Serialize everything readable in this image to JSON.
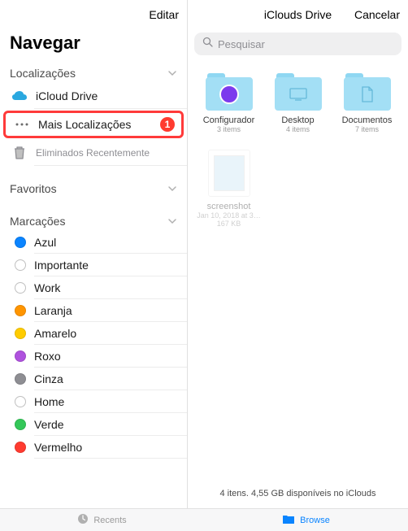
{
  "sidebar": {
    "edit_label": "Editar",
    "title": "Navegar",
    "sections": {
      "locations": {
        "header": "Localizações",
        "items": [
          {
            "label": "iCloud Drive"
          },
          {
            "label": "Mais Localizações",
            "badge": "1"
          },
          {
            "label": "Eliminados Recentemente"
          }
        ]
      },
      "favorites": {
        "header": "Favoritos"
      },
      "tags": {
        "header": "Marcações",
        "items": [
          {
            "label": "Azul",
            "color": "#0a84ff"
          },
          {
            "label": "Importante",
            "hollow": true
          },
          {
            "label": "Work",
            "hollow": true
          },
          {
            "label": "Laranja",
            "color": "#ff9500"
          },
          {
            "label": "Amarelo",
            "color": "#ffcc00"
          },
          {
            "label": "Roxo",
            "color": "#af52de"
          },
          {
            "label": "Cinza",
            "color": "#8e8e93"
          },
          {
            "label": "Home",
            "hollow": true
          },
          {
            "label": "Verde",
            "color": "#34c759"
          },
          {
            "label": "Vermelho",
            "color": "#ff3b30"
          }
        ]
      }
    }
  },
  "main": {
    "title": "iClouds Drive",
    "cancel_label": "Cancelar",
    "search_placeholder": "Pesquisar",
    "items": [
      {
        "name": "Configurador",
        "meta": "3 items",
        "kind": "folder-config"
      },
      {
        "name": "Desktop",
        "meta": "4 items",
        "kind": "folder-desktop"
      },
      {
        "name": "Documentos",
        "meta": "7 items",
        "kind": "folder-docs"
      },
      {
        "name": "screenshot",
        "meta": "Jan 10, 2018 at 3…",
        "meta2": "167 KB",
        "kind": "file",
        "dim": true
      }
    ],
    "status": "4 itens. 4,55 GB disponíveis no iClouds"
  },
  "tabs": {
    "recents": "Recents",
    "browse": "Browse"
  }
}
